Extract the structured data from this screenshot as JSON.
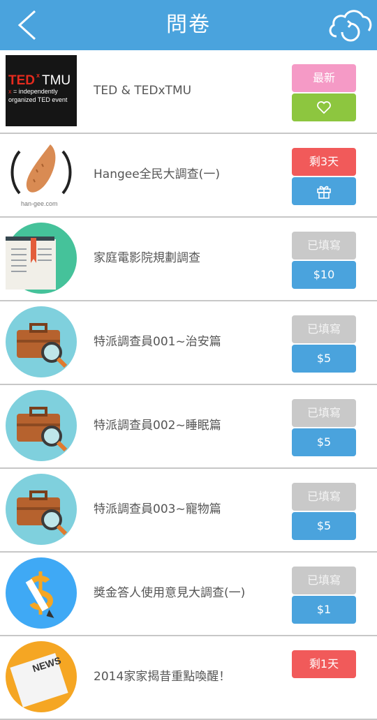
{
  "header": {
    "title": "問卷"
  },
  "surveys": [
    {
      "title": "TED & TEDxTMU",
      "status": "最新",
      "reward": "",
      "thumb": "tedx-logo"
    },
    {
      "title": "Hangee全民大調查(一)",
      "status": "剩3天",
      "reward": "",
      "thumb": "hangee-logo"
    },
    {
      "title": "家庭電影院規劃調查",
      "status": "已填寫",
      "reward": "$10",
      "thumb": "book-icon"
    },
    {
      "title": "特派調查員001~治安篇",
      "status": "已填寫",
      "reward": "$5",
      "thumb": "briefcase-magnifier-icon"
    },
    {
      "title": "特派調查員002~睡眠篇",
      "status": "已填寫",
      "reward": "$5",
      "thumb": "briefcase-magnifier-icon"
    },
    {
      "title": "特派調查員003~寵物篇",
      "status": "已填寫",
      "reward": "$5",
      "thumb": "briefcase-magnifier-icon"
    },
    {
      "title": "獎金答人使用意見大調查(一)",
      "status": "已填寫",
      "reward": "$1",
      "thumb": "dollar-pencil-icon"
    },
    {
      "title": "2014家家揭昔重點喚醒！",
      "status": "剩1天",
      "reward": "",
      "thumb": "newspaper-icon"
    }
  ],
  "ted_logo": {
    "line1": "TEDx TMU",
    "line2": "x = independently",
    "line3": "organized TED event"
  },
  "hangee_logo": {
    "text": "han-gee.com"
  },
  "icons": {
    "back": "chevron-left-icon",
    "sync": "cloud-sync-icon",
    "like": "heart-icon",
    "gift": "gift-icon"
  }
}
